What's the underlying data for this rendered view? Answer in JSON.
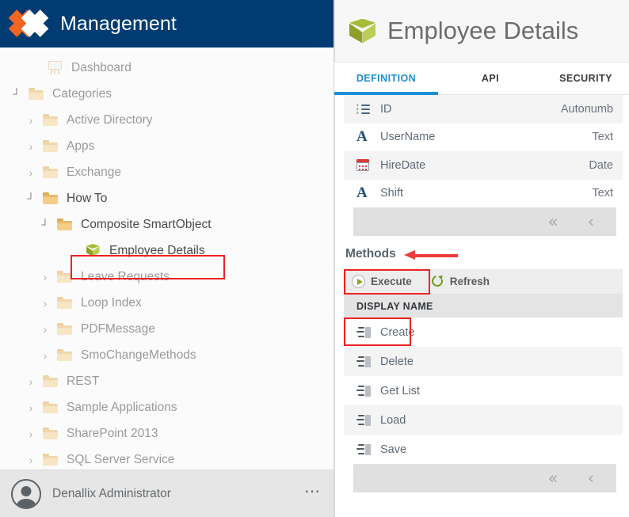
{
  "brand": {
    "title": "Management",
    "logo_icon": "k2-x-logo"
  },
  "sidebar": {
    "items": [
      {
        "label": "Dashboard",
        "icon": "dashboard-easel-icon",
        "twisty": "",
        "indent": 34,
        "tone": "muted"
      },
      {
        "label": "Categories",
        "icon": "folder-icon",
        "twisty": "┘",
        "indent": 10,
        "tone": "muted"
      },
      {
        "label": "Active Directory",
        "icon": "folder-icon",
        "twisty": "›",
        "indent": 28,
        "tone": "muted"
      },
      {
        "label": "Apps",
        "icon": "folder-icon",
        "twisty": "›",
        "indent": 28,
        "tone": "muted"
      },
      {
        "label": "Exchange",
        "icon": "folder-icon",
        "twisty": "›",
        "indent": 28,
        "tone": "muted"
      },
      {
        "label": "How To",
        "icon": "folder-icon",
        "twisty": "┘",
        "indent": 28,
        "tone": "dark"
      },
      {
        "label": "Composite SmartObject",
        "icon": "folder-icon",
        "twisty": "┘",
        "indent": 46,
        "tone": "dark"
      },
      {
        "label": "Employee Details",
        "icon": "smartobject-cube-icon",
        "twisty": "",
        "indent": 82,
        "tone": "dark"
      },
      {
        "label": "Leave Requests",
        "icon": "folder-icon",
        "twisty": "›",
        "indent": 46,
        "tone": "muted"
      },
      {
        "label": "Loop Index",
        "icon": "folder-icon",
        "twisty": "›",
        "indent": 46,
        "tone": "muted"
      },
      {
        "label": "PDFMessage",
        "icon": "folder-icon",
        "twisty": "›",
        "indent": 46,
        "tone": "muted"
      },
      {
        "label": "SmoChangeMethods",
        "icon": "folder-icon",
        "twisty": "›",
        "indent": 46,
        "tone": "muted"
      },
      {
        "label": "REST",
        "icon": "folder-icon",
        "twisty": "›",
        "indent": 28,
        "tone": "muted"
      },
      {
        "label": "Sample Applications",
        "icon": "folder-icon",
        "twisty": "›",
        "indent": 28,
        "tone": "muted"
      },
      {
        "label": "SharePoint 2013",
        "icon": "folder-icon",
        "twisty": "›",
        "indent": 28,
        "tone": "muted"
      },
      {
        "label": "SQL Server Service",
        "icon": "folder-icon",
        "twisty": "›",
        "indent": 28,
        "tone": "muted"
      }
    ]
  },
  "user": {
    "name": "Denallix Administrator",
    "avatar_icon": "user-avatar-icon",
    "menu_icon": "ellipsis-icon"
  },
  "detail": {
    "title": "Employee Details",
    "title_icon": "smartobject-cube-icon",
    "tabs": [
      {
        "label": "DEFINITION",
        "active": true
      },
      {
        "label": "API",
        "active": false
      },
      {
        "label": "SECURITY",
        "active": false
      }
    ],
    "properties": [
      {
        "name": "ID",
        "type": "Autonumb",
        "icon": "numbered-list-icon"
      },
      {
        "name": "UserName",
        "type": "Text",
        "icon": "text-a-icon"
      },
      {
        "name": "HireDate",
        "type": "Date",
        "icon": "calendar-icon"
      },
      {
        "name": "Shift",
        "type": "Text",
        "icon": "text-a-icon"
      }
    ],
    "properties_pager": {
      "first": "«",
      "prev": "‹"
    },
    "methods_section": {
      "title": "Methods",
      "annotation_icon": "red-left-arrow-annotation"
    },
    "methods_toolbar": [
      {
        "label": "Execute",
        "icon": "play-circle-icon"
      },
      {
        "label": "Refresh",
        "icon": "refresh-icon"
      }
    ],
    "methods_column_header": "DISPLAY NAME",
    "methods": [
      {
        "name": "Create",
        "icon": "method-icon"
      },
      {
        "name": "Delete",
        "icon": "method-icon"
      },
      {
        "name": "Get List",
        "icon": "method-icon"
      },
      {
        "name": "Load",
        "icon": "method-icon"
      },
      {
        "name": "Save",
        "icon": "method-icon"
      }
    ],
    "methods_pager": {
      "first": "«",
      "prev": "‹"
    }
  },
  "colors": {
    "brand_bar": "#003b71",
    "logo_orange": "#f26522",
    "accent_blue": "#1a8fd4",
    "annotation_red": "#ee2222",
    "cube_green": "#a8bb38"
  }
}
